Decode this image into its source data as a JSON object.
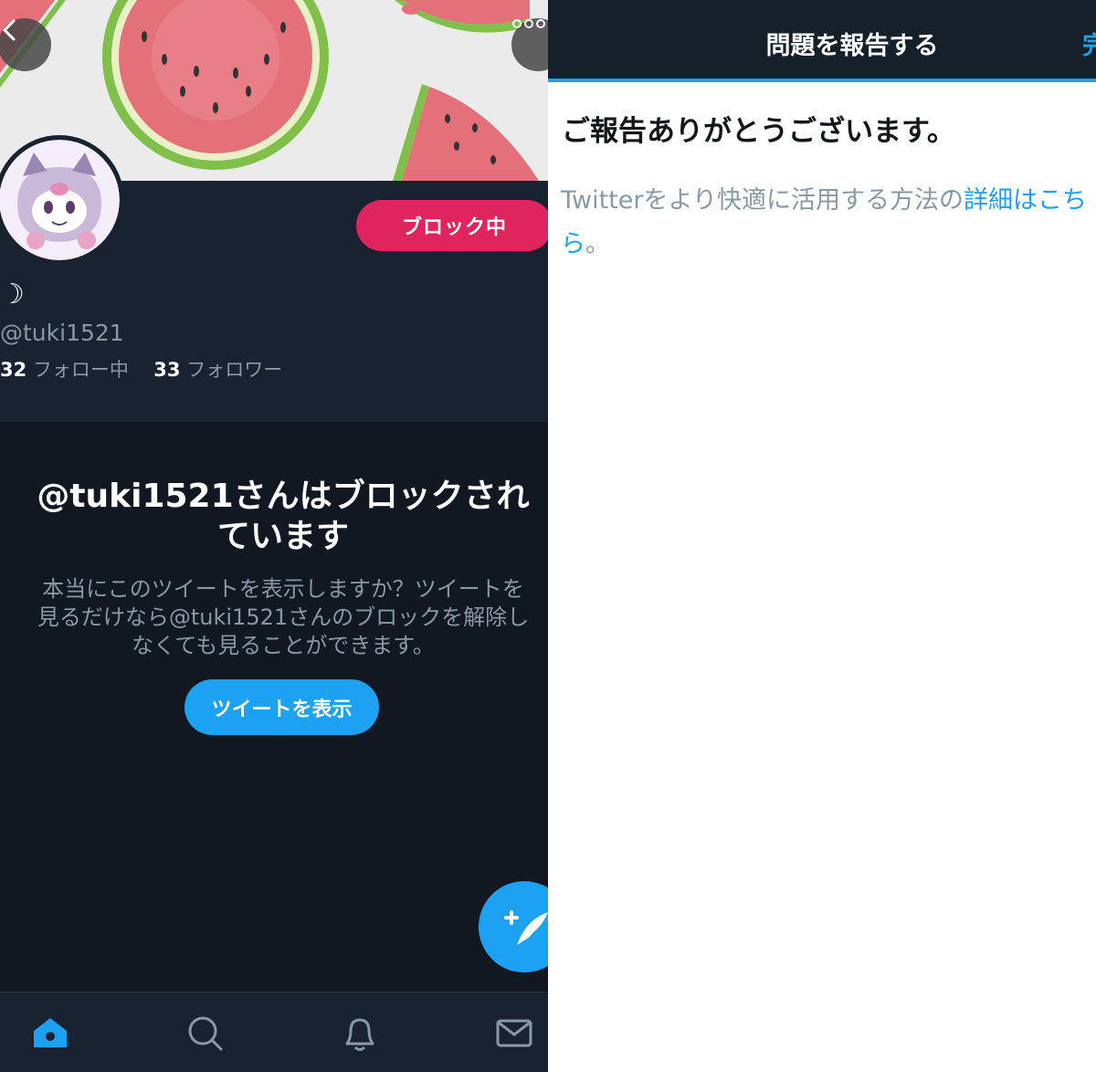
{
  "profile": {
    "display_name": "☽",
    "handle": "@tuki1521",
    "following_count": "32",
    "following_label": "フォロー中",
    "followers_count": "33",
    "followers_label": "フォロワー",
    "blocked_button_label": "ブロック中"
  },
  "blocked_notice": {
    "title": "@tuki1521さんはブロックされています",
    "description": "本当にこのツイートを表示しますか？ツイートを見るだけなら@tuki1521さんのブロックを解除しなくても見ることができます。",
    "view_button_label": "ツイートを表示"
  },
  "report": {
    "header_title": "問題を報告する",
    "done_label": "完",
    "thanks_message": "ご報告ありがとうございます。",
    "info_text": "Twitterをより快適に活用する方法の",
    "info_link": "詳細はこちら",
    "info_suffix": "。"
  },
  "colors": {
    "twitter_blue": "#1da1f2",
    "block_red": "#e0245e",
    "dark_bg": "#14171f",
    "muted_text": "#8899a6"
  },
  "icons": {
    "back": "chevron-left-icon",
    "more": "more-horizontal-icon",
    "compose": "compose-tweet-icon",
    "home": "home-icon",
    "search": "search-icon",
    "notifications": "bell-icon",
    "messages": "mail-icon"
  }
}
